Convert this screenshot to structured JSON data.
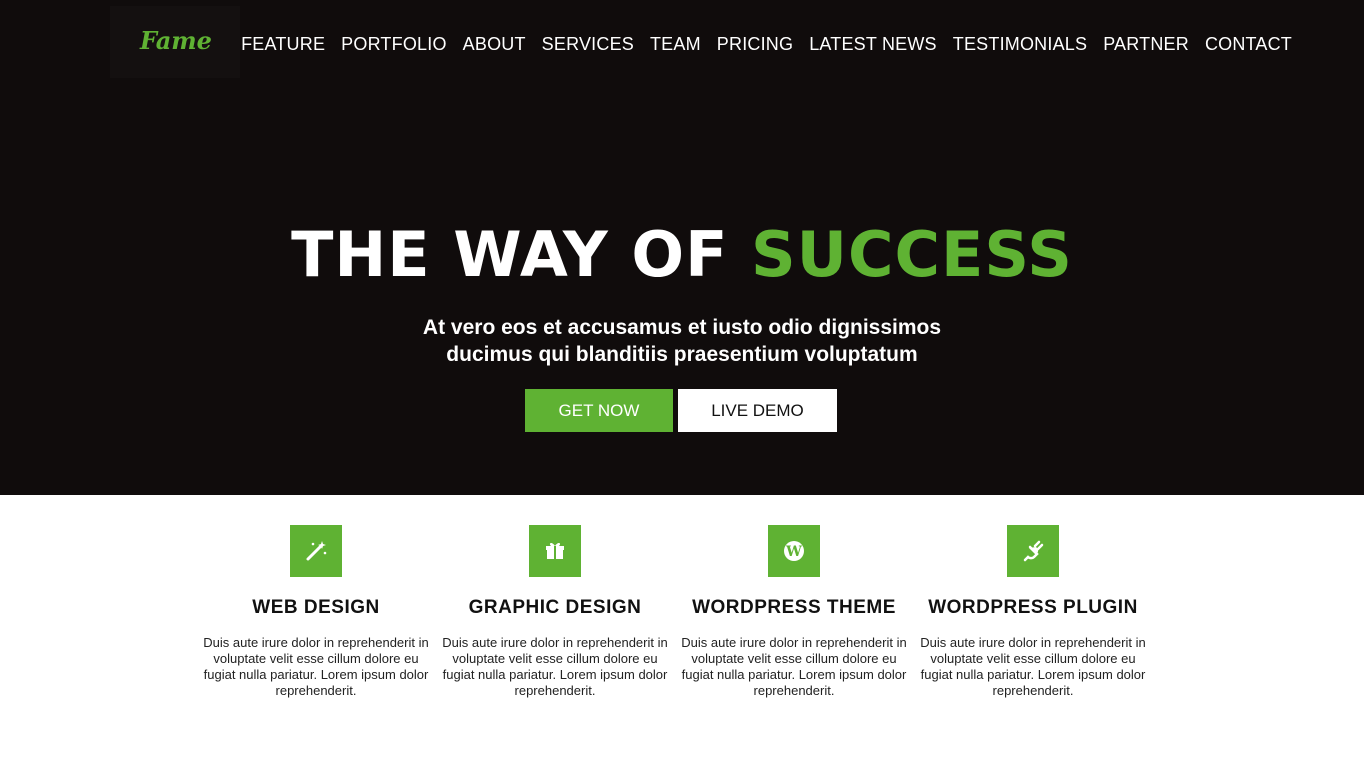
{
  "logo": {
    "text": "Fame"
  },
  "nav": [
    "FEATURE",
    "PORTFOLIO",
    "ABOUT",
    "SERVICES",
    "TEAM",
    "PRICING",
    "LATEST NEWS",
    "TESTIMONIALS",
    "PARTNER",
    "CONTACT"
  ],
  "hero": {
    "headline_main": "THE WAY OF ",
    "headline_accent": "SUCCESS",
    "sub_line1": "At vero eos et accusamus et iusto odio dignissimos",
    "sub_line2": "ducimus qui blanditiis praesentium voluptatum",
    "btn_get": "GET NOW",
    "btn_demo": "LIVE DEMO"
  },
  "features": [
    {
      "icon": "magic-wand-icon",
      "title": "WEB DESIGN",
      "desc": "Duis aute irure dolor in reprehenderit in voluptate velit esse cillum dolore eu fugiat nulla pariatur. Lorem ipsum dolor reprehenderit."
    },
    {
      "icon": "gift-icon",
      "title": "GRAPHIC DESIGN",
      "desc": "Duis aute irure dolor in reprehenderit in voluptate velit esse cillum dolore eu fugiat nulla pariatur. Lorem ipsum dolor reprehenderit."
    },
    {
      "icon": "wordpress-icon",
      "title": "WORDPRESS THEME",
      "desc": "Duis aute irure dolor in reprehenderit in voluptate velit esse cillum dolore eu fugiat nulla pariatur. Lorem ipsum dolor reprehenderit."
    },
    {
      "icon": "plug-icon",
      "title": "WORDPRESS PLUGIN",
      "desc": "Duis aute irure dolor in reprehenderit in voluptate velit esse cillum dolore eu fugiat nulla pariatur. Lorem ipsum dolor reprehenderit."
    }
  ],
  "colors": {
    "accent": "#5fb233",
    "hero_bg": "#100c0c"
  }
}
